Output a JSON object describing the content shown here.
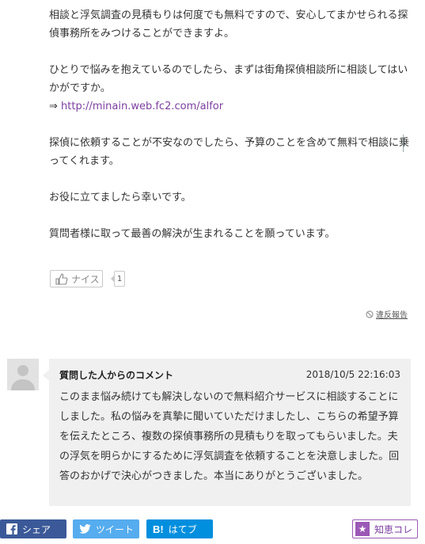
{
  "answer": {
    "paragraph1": "相談と浮気調査の見積もりは何度でも無料ですので、安心してまかせられる探偵事務所をみつけることができますよ。",
    "paragraph2": "ひとりで悩みを抱えているのでしたら、まずは街角探偵相談所に相談してはいかがですか。",
    "link_arrow": "⇒",
    "link_text": "http://minain.web.fc2.com/alfor",
    "paragraph3": "探偵に依頼することが不安なのでしたら、予算のことを含めて無料で相談に乗ってくれます。",
    "paragraph4": "お役に立てましたら幸いです。",
    "paragraph5": "質問者様に取って最善の解決が生まれることを願っています。"
  },
  "reaction": {
    "nice_label": "ナイス",
    "nice_count": "1"
  },
  "report": {
    "label": "違反報告"
  },
  "comment": {
    "title": "質問した人からのコメント",
    "date": "2018/10/5 22:16:03",
    "body": "このまま悩み続けても解決しないので無料紹介サービスに相談することにしました。私の悩みを真摯に聞いていただけましたし、こちらの希望予算を伝えたところ、複数の探偵事務所の見積もりを取ってもらいました。夫の浮気を明らかにするために浮気調査を依頼することを決意しました。回答のおかげで決心がつきました。本当にありがとうございました。"
  },
  "share": {
    "facebook_label": "シェア",
    "twitter_label": "ツイート",
    "hatena_mark": "B!",
    "hatena_label": "はてブ",
    "chie_label": "知恵コレ",
    "colors": {
      "facebook": "#3b5998",
      "twitter": "#55acee",
      "hatena": "#008fde",
      "chie": "#9b59b6"
    }
  }
}
